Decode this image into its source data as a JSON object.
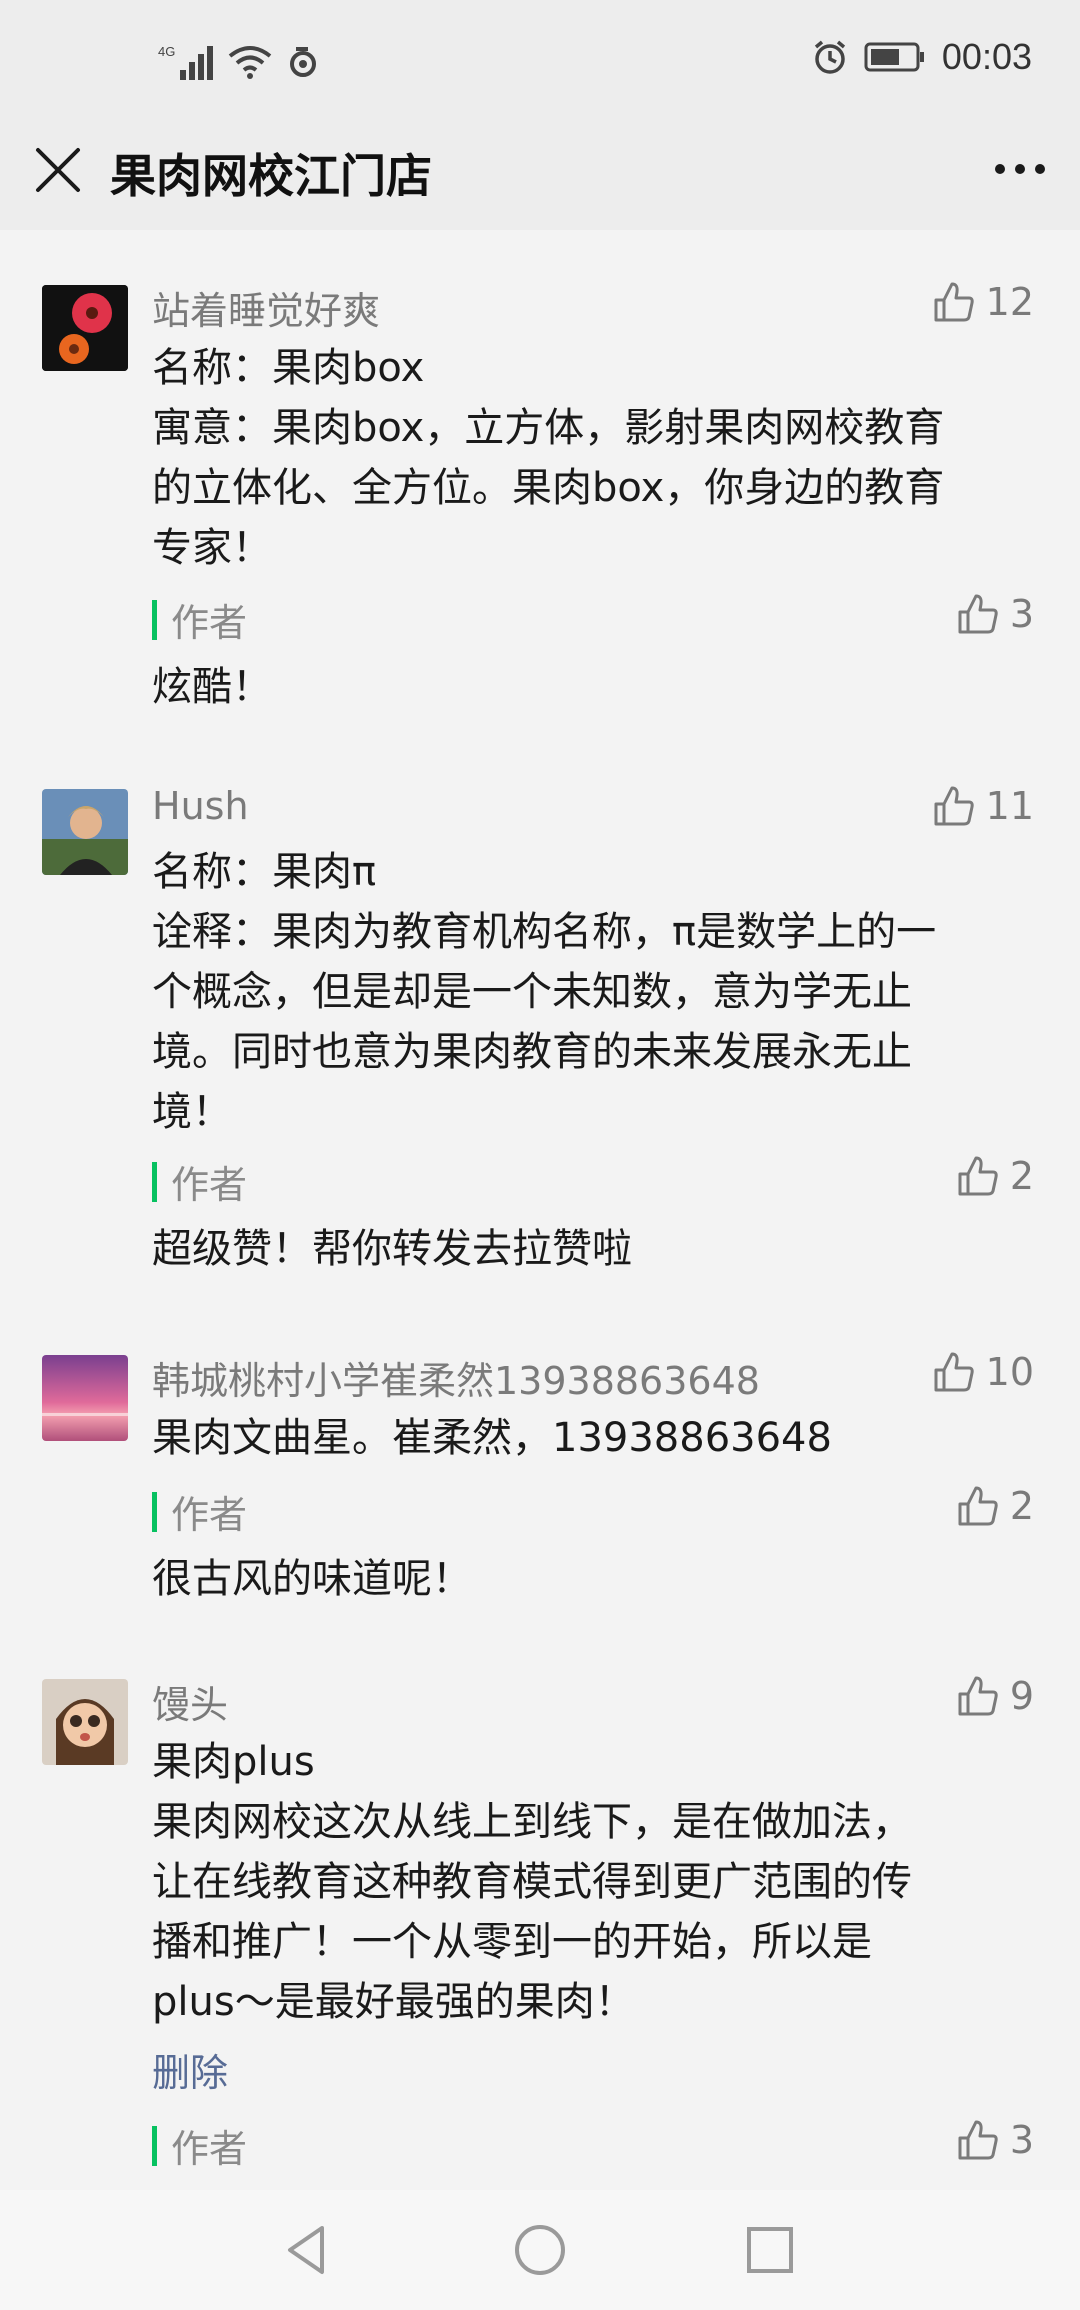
{
  "status_bar": {
    "network": "4G",
    "time": "00:03"
  },
  "nav": {
    "title": "果肉网校江门店"
  },
  "comments": [
    {
      "nickname": "站着睡觉好爽",
      "likes": "12",
      "lines": [
        "名称：果肉box",
        "寓意：果肉box，立方体，影射果肉网校教育",
        "的立体化、全方位。果肉box，你身边的教育",
        "专家！"
      ],
      "reply": {
        "label": "作者",
        "likes": "3",
        "text": "炫酷！"
      }
    },
    {
      "nickname": "Hush",
      "likes": "11",
      "lines": [
        "名称：果肉π",
        "诠释：果肉为教育机构名称，π是数学上的一",
        "个概念，但是却是一个未知数，意为学无止",
        "境。同时也意为果肉教育的未来发展永无止",
        "境！"
      ],
      "reply": {
        "label": "作者",
        "likes": "2",
        "text": "超级赞！帮你转发去拉赞啦"
      }
    },
    {
      "nickname": "韩城桃村小学崔柔然13938863648",
      "likes": "10",
      "lines": [
        "果肉文曲星。崔柔然，13938863648"
      ],
      "reply": {
        "label": "作者",
        "likes": "2",
        "text": "很古风的味道呢！"
      }
    },
    {
      "nickname": "馒头",
      "likes": "9",
      "lines": [
        "果肉plus",
        "果肉网校这次从线上到线下，是在做加法，",
        "让在线教育这种教育模式得到更广范围的传",
        "播和推广！一个从零到一的开始，所以是",
        "plus～是最好最强的果肉！"
      ],
      "delete_label": "删除",
      "reply": {
        "label": "作者",
        "likes": "3",
        "text": ""
      }
    }
  ],
  "icons": {
    "close": "close-icon",
    "more": "more-icon",
    "like": "thumbs-up-icon",
    "back": "triangle-back-icon",
    "home": "circle-home-icon",
    "recent": "square-recent-icon"
  },
  "colors": {
    "accent_green": "#07c160",
    "link_blue": "#576b95"
  }
}
